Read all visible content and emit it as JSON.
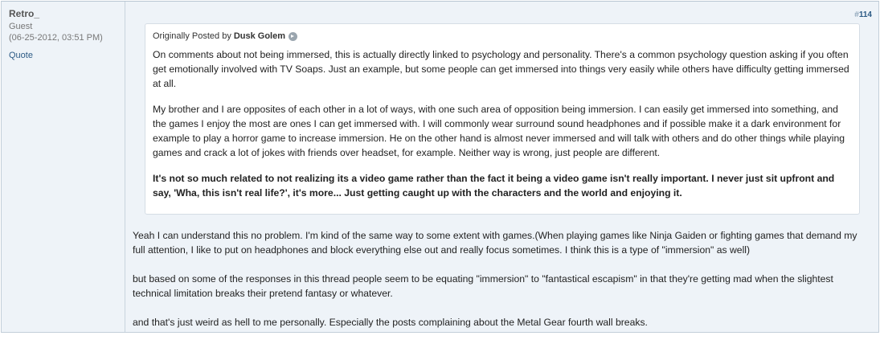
{
  "user": {
    "name": "Retro_",
    "title": "Guest",
    "date": "(06-25-2012, 03:51 PM)",
    "quote_label": "Quote"
  },
  "post": {
    "number_hash": "#",
    "number": "114"
  },
  "quote": {
    "prefix": "Originally Posted by",
    "author": "Dusk Golem",
    "paragraphs": [
      "On comments about not being immersed, this is actually directly linked to psychology and personality. There's a common psychology question asking if you often get emotionally involved with TV Soaps. Just an example, but some people can get immersed into things very easily while others have difficulty getting immersed at all.",
      "My brother and I are opposites of each other in a lot of ways, with one such area of opposition being immersion. I can easily get immersed into something, and the games I enjoy the most are ones I can get immersed with. I will commonly wear surround sound headphones and if possible make it a dark environment for example to play a horror game to increase immersion. He on the other hand is almost never immersed and will talk with others and do other things while playing games and crack a lot of jokes with friends over headset, for example. Neither way is wrong, just people are different.",
      "It's not so much related to not realizing its a video game rather than the fact it being a video game isn't really important. I never just sit upfront and say, 'Wha, this isn't real life?', it's more... Just getting caught up with the characters and the world and enjoying it."
    ]
  },
  "reply": {
    "paragraphs": [
      "Yeah I can understand this no problem. I'm kind of the same way to some extent with games.(When playing games like Ninja Gaiden or fighting games that demand my full attention, I like to put on headphones and block everything else out and really focus sometimes. I think this is a type of \"immersion\" as well)",
      "but based on some of the responses in this thread people seem to be equating \"immersion\" to \"fantastical escapism\" in that they're getting mad when the slightest technical limitation breaks their pretend fantasy or whatever.",
      "and that's just weird as hell to me personally. Especially the posts complaining about the Metal Gear fourth wall breaks."
    ]
  }
}
